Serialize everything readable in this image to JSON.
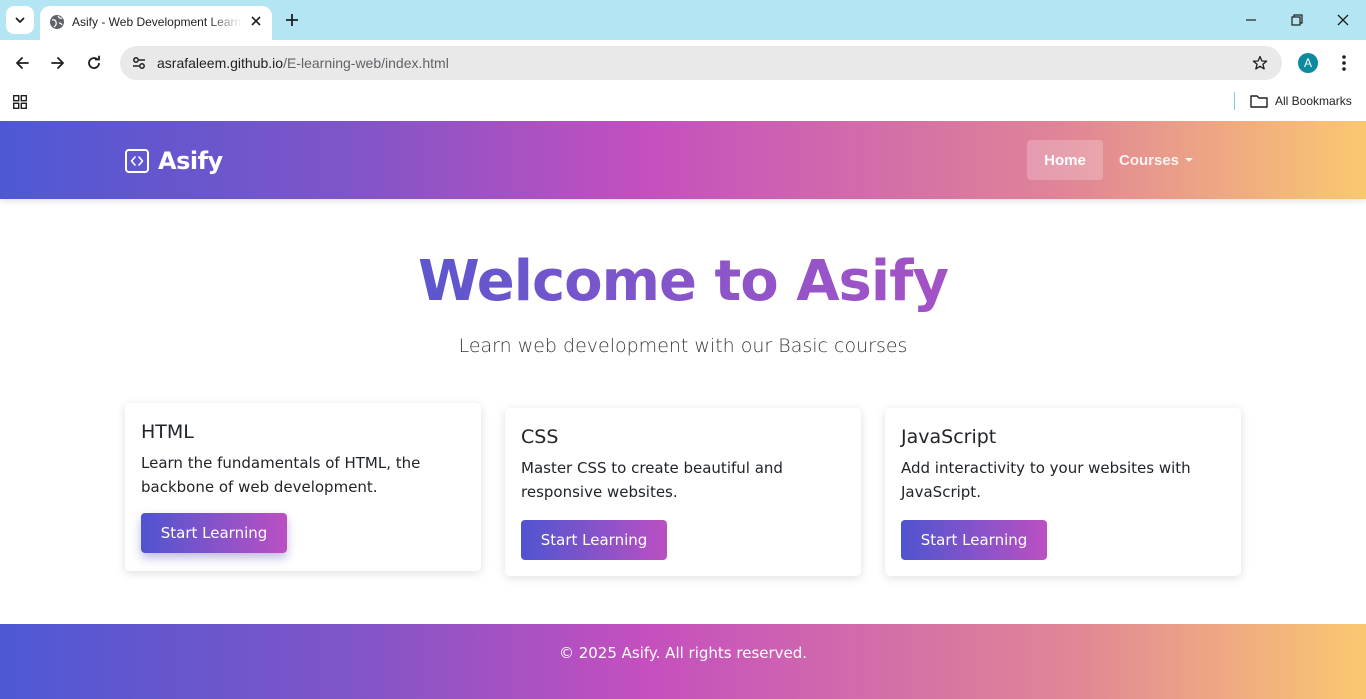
{
  "browser": {
    "tab_title": "Asify - Web Development Learning",
    "url_host": "asrafaleem.github.io",
    "url_path": "/E-learning-web/index.html",
    "profile_initial": "A",
    "bookmarks_label": "All Bookmarks",
    "icons": [
      "chevron-down-icon",
      "globe-icon",
      "close-icon",
      "plus-icon",
      "minimize-icon",
      "restore-icon",
      "back-icon",
      "forward-icon",
      "reload-icon",
      "site-settings-icon",
      "star-icon",
      "more-vert-icon",
      "apps-icon",
      "folder-icon"
    ]
  },
  "navbar": {
    "brand": "Asify",
    "brand_icon": "code-square-icon",
    "links": [
      {
        "label": "Home",
        "active": true
      },
      {
        "label": "Courses",
        "dropdown": true
      }
    ]
  },
  "hero": {
    "title": "Welcome to Asify",
    "subtitle": "Learn web development with our Basic courses"
  },
  "courses": [
    {
      "title": "HTML",
      "description": "Learn the fundamentals of HTML, the backbone of web development.",
      "button": "Start Learning"
    },
    {
      "title": "CSS",
      "description": "Master CSS to create beautiful and responsive websites.",
      "button": "Start Learning"
    },
    {
      "title": "JavaScript",
      "description": "Add interactivity to your websites with JavaScript.",
      "button": "Start Learning"
    }
  ],
  "footer": {
    "text": "© 2025 Asify. All rights reserved."
  },
  "colors": {
    "gradient": [
      "#4e58d4",
      "#c44fbf",
      "#fbc870"
    ],
    "tabstrip": "#b3e6f2"
  }
}
